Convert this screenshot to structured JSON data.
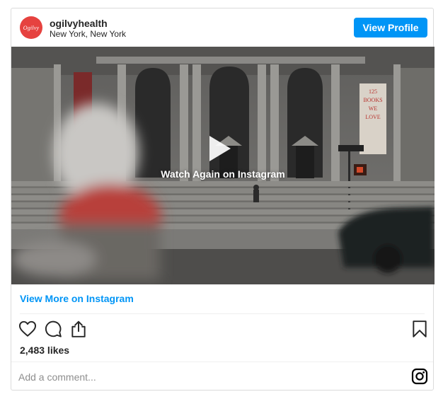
{
  "post": {
    "username": "ogilvyhealth",
    "location": "New York, New York",
    "avatar_text": "Ogilvy",
    "view_profile_label": "View Profile",
    "watch_again_label": "Watch Again on Instagram",
    "view_more_label": "View More on Instagram",
    "likes_text": "2,483 likes",
    "comment_placeholder": "Add a comment...",
    "banner_text": [
      "125",
      "BOOKS",
      "WE",
      "LOVE"
    ]
  },
  "icons": {
    "like": "heart-icon",
    "comment": "comment-icon",
    "share": "share-icon",
    "save": "bookmark-icon",
    "instagram": "instagram-icon",
    "play": "play-icon"
  },
  "colors": {
    "accent": "#0095f6",
    "avatar_bg": "#e6423f",
    "text": "#262626",
    "muted": "#8e8e8e",
    "border": "#dbdbdb"
  }
}
